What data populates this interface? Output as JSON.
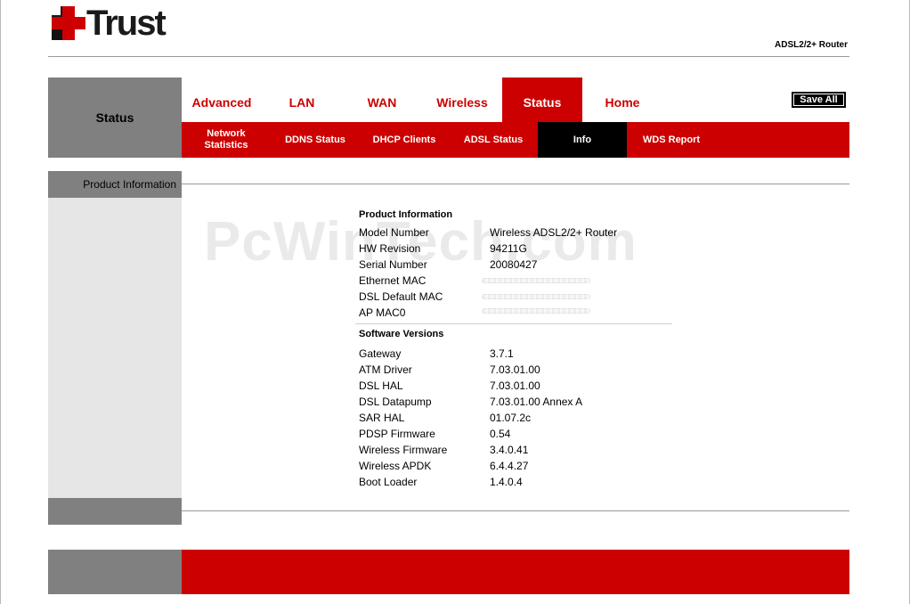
{
  "header": {
    "brand": "Trust",
    "model": "ADSL2/2+ Router"
  },
  "nav": {
    "current_section": "Status",
    "main_tabs": [
      {
        "label": "Advanced"
      },
      {
        "label": "LAN"
      },
      {
        "label": "WAN"
      },
      {
        "label": "Wireless"
      },
      {
        "label": "Status",
        "active": true
      },
      {
        "label": "Home"
      }
    ],
    "save_label": "Save All",
    "sub_tabs": [
      {
        "label": "Network\nStatistics"
      },
      {
        "label": "DDNS Status"
      },
      {
        "label": "DHCP Clients"
      },
      {
        "label": "ADSL Status"
      },
      {
        "label": "Info",
        "active": true
      },
      {
        "label": "WDS Report"
      }
    ]
  },
  "sidebar": {
    "heading": "Product Information"
  },
  "watermark": "PcWinTech.com",
  "product": {
    "heading": "Product Information",
    "rows": [
      {
        "key": "Model Number",
        "value": "Wireless ADSL2/2+ Router"
      },
      {
        "key": "HW Revision",
        "value": "94211G"
      },
      {
        "key": "Serial Number",
        "value": "20080427"
      },
      {
        "key": "Ethernet MAC",
        "value": ""
      },
      {
        "key": "DSL Default MAC",
        "value": ""
      },
      {
        "key": "AP MAC0",
        "value": ""
      }
    ]
  },
  "software": {
    "heading": "Software Versions",
    "rows": [
      {
        "key": "Gateway",
        "value": "3.7.1"
      },
      {
        "key": "ATM Driver",
        "value": "7.03.01.00"
      },
      {
        "key": "DSL HAL",
        "value": "7.03.01.00"
      },
      {
        "key": "DSL Datapump",
        "value": "7.03.01.00 Annex A"
      },
      {
        "key": "SAR HAL",
        "value": "01.07.2c"
      },
      {
        "key": "PDSP Firmware",
        "value": "0.54"
      },
      {
        "key": "Wireless Firmware",
        "value": "3.4.0.41"
      },
      {
        "key": "Wireless APDK",
        "value": "6.4.4.27"
      },
      {
        "key": "Boot Loader",
        "value": "1.4.0.4"
      }
    ]
  },
  "colors": {
    "brand_red": "#cc0000",
    "grey": "#808080",
    "sidebar_bg": "#e6e6e6",
    "active_sub_tab": "#000000"
  }
}
